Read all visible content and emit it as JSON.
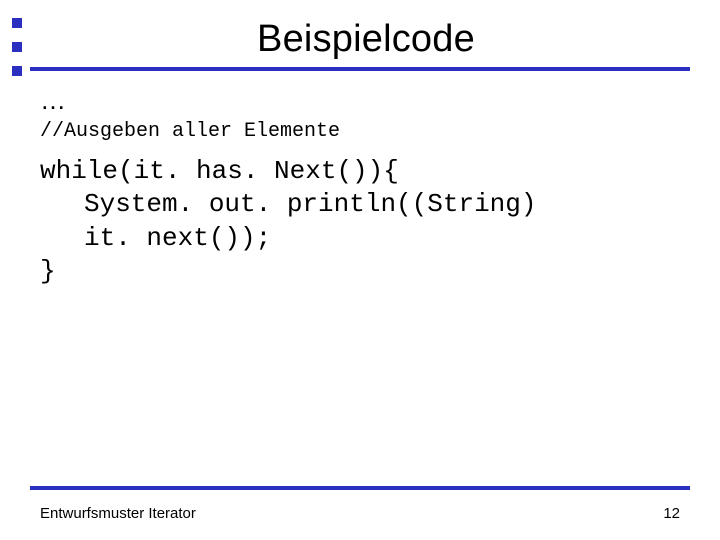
{
  "title": "Beispielcode",
  "content": {
    "ellipsis": "…",
    "comment": "//Ausgeben aller Elemente",
    "code": {
      "line1": "while(it. has. Next()){",
      "line2": "System. out. println((String)",
      "line3": "it. next());",
      "line4": "}"
    }
  },
  "footer": {
    "left": "Entwurfsmuster Iterator",
    "page": "12"
  },
  "colors": {
    "accent": "#2b2fbf"
  }
}
